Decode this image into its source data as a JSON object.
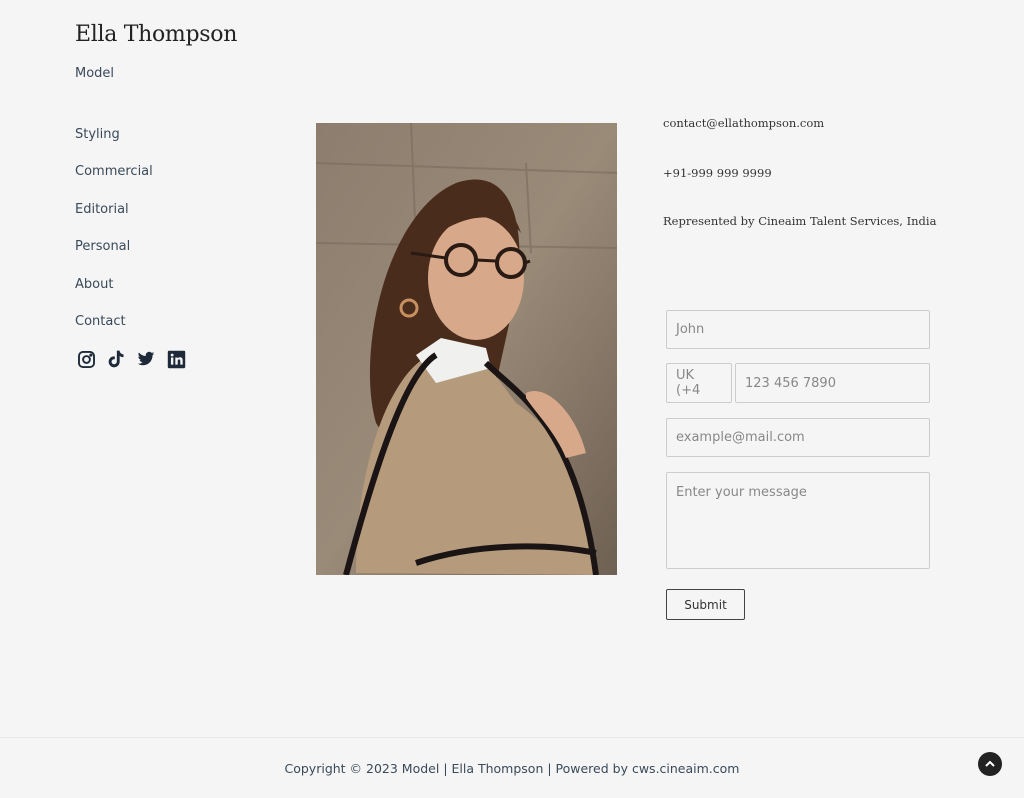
{
  "header": {
    "title": "Ella Thompson",
    "tagline": "Model"
  },
  "nav": {
    "items": [
      {
        "label": "Styling"
      },
      {
        "label": "Commercial"
      },
      {
        "label": "Editorial"
      },
      {
        "label": "Personal"
      },
      {
        "label": "About"
      },
      {
        "label": "Contact"
      }
    ]
  },
  "social": [
    "instagram-icon",
    "tiktok-icon",
    "twitter-icon",
    "linkedin-icon"
  ],
  "photo": {
    "alt": "Woman in glasses wearing a beige cape with black trim"
  },
  "contact": {
    "email": "contact@ellathompson.com",
    "phone": "+91-999 999 9999",
    "representation": "Represented by Cineaim Talent Services, India"
  },
  "form": {
    "name_placeholder": "John",
    "country_code": "UK (+4",
    "phone_placeholder": "123 456 7890",
    "email_placeholder": "example@mail.com",
    "message_placeholder": "Enter your message",
    "submit_label": "Submit"
  },
  "footer": {
    "text": "Copyright © 2023 Model | Ella Thompson | Powered by cws.cineaim.com"
  }
}
